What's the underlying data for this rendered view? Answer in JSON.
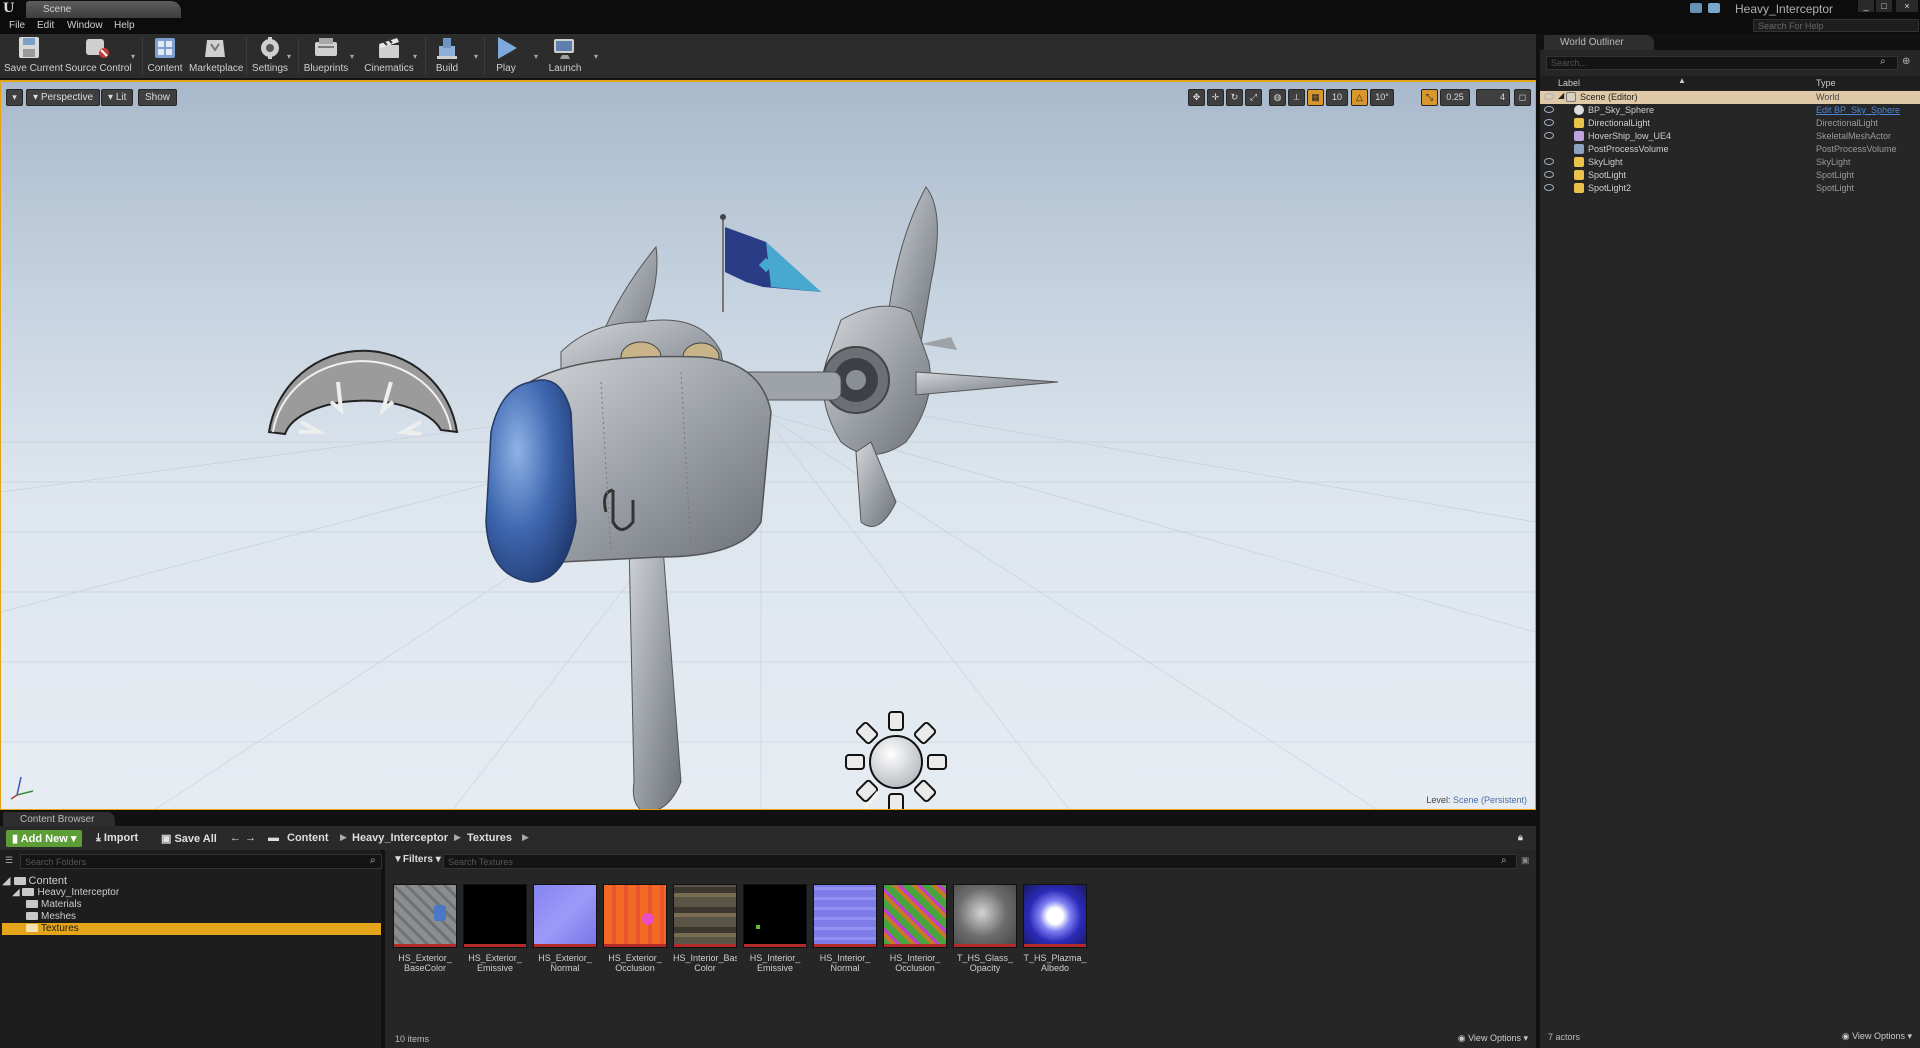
{
  "titlebar": {
    "tab_label": "Scene",
    "project_name": "Heavy_Interceptor",
    "window_buttons": [
      "_",
      "□",
      "×"
    ]
  },
  "menu": {
    "items": [
      "File",
      "Edit",
      "Window",
      "Help"
    ],
    "help_search_placeholder": "Search For Help"
  },
  "toolbar": {
    "buttons": [
      {
        "label": "Save Current",
        "icon": "save-icon"
      },
      {
        "label": "Source Control",
        "icon": "source-control-icon"
      },
      {
        "label": "Content",
        "icon": "content-icon"
      },
      {
        "label": "Marketplace",
        "icon": "marketplace-icon"
      },
      {
        "label": "Settings",
        "icon": "settings-icon"
      },
      {
        "label": "Blueprints",
        "icon": "blueprints-icon"
      },
      {
        "label": "Cinematics",
        "icon": "cinematics-icon"
      },
      {
        "label": "Build",
        "icon": "build-icon"
      },
      {
        "label": "Play",
        "icon": "play-icon"
      },
      {
        "label": "Launch",
        "icon": "launch-icon"
      }
    ]
  },
  "viewport": {
    "perspective": "Perspective",
    "lit": "Lit",
    "show": "Show",
    "grid_snap": "10",
    "rotation_snap": "10°",
    "scale_snap": "0.25",
    "camera_speed": "4",
    "level_label": "Level:",
    "level_value": "Scene (Persistent)"
  },
  "content_browser": {
    "tab_label": "Content Browser",
    "add_new": "Add New",
    "import": "Import",
    "save_all": "Save All",
    "breadcrumbs": [
      "Content",
      "Heavy_Interceptor",
      "Textures"
    ],
    "folder_search_placeholder": "Search Folders",
    "filters": "Filters",
    "asset_search_placeholder": "Search Textures",
    "folders": [
      {
        "name": "Content",
        "level": 0
      },
      {
        "name": "Heavy_Interceptor",
        "level": 1
      },
      {
        "name": "Materials",
        "level": 2
      },
      {
        "name": "Meshes",
        "level": 2
      },
      {
        "name": "Textures",
        "level": 2
      }
    ],
    "assets": [
      {
        "name": "HS_Exterior_ BaseColor",
        "color": "#8a8e90"
      },
      {
        "name": "HS_Exterior_ Emissive",
        "color": "#000000"
      },
      {
        "name": "HS_Exterior_ Normal",
        "color": "#8684f0"
      },
      {
        "name": "HS_Exterior_ Occlusion Roughness",
        "color": "#f26a26"
      },
      {
        "name": "HS_Interior_Base Color",
        "color": "#5a5446"
      },
      {
        "name": "HS_Interior_ Emissive",
        "color": "#000000"
      },
      {
        "name": "HS_Interior_ Normal",
        "color": "#7d7ce8"
      },
      {
        "name": "HS_Interior_ Occlusion Roughness",
        "color": "#48a43e"
      },
      {
        "name": "T_HS_Glass_ Opacity",
        "color": "#6d6d6d"
      },
      {
        "name": "T_HS_Plazma_ Albedo Transparency",
        "color": "#2a2ab8"
      }
    ],
    "item_count": "10 items",
    "view_options": "View Options"
  },
  "outliner": {
    "tab_label": "World Outliner",
    "search_placeholder": "Search...",
    "col_label": "Label",
    "col_type": "Type",
    "rows": [
      {
        "label": "Scene (Editor)",
        "type": "World",
        "link": false,
        "icon_color": "#d9d1c0"
      },
      {
        "label": "BP_Sky_Sphere",
        "type": "Edit BP_Sky_Sphere",
        "link": true,
        "icon_color": "#dddddd"
      },
      {
        "label": "DirectionalLight",
        "type": "DirectionalLight",
        "link": false,
        "icon_color": "#e8c24a"
      },
      {
        "label": "HoverShip_low_UE4",
        "type": "SkeletalMeshActor",
        "link": false,
        "icon_color": "#bfa3e0"
      },
      {
        "label": "PostProcessVolume",
        "type": "PostProcessVolume",
        "link": false,
        "icon_color": "#8fa3c0"
      },
      {
        "label": "SkyLight",
        "type": "SkyLight",
        "link": false,
        "icon_color": "#e8c24a"
      },
      {
        "label": "SpotLight",
        "type": "SpotLight",
        "link": false,
        "icon_color": "#e8c24a"
      },
      {
        "label": "SpotLight2",
        "type": "SpotLight",
        "link": false,
        "icon_color": "#e8c24a"
      }
    ],
    "actor_count": "7 actors",
    "view_options": "View Options"
  }
}
